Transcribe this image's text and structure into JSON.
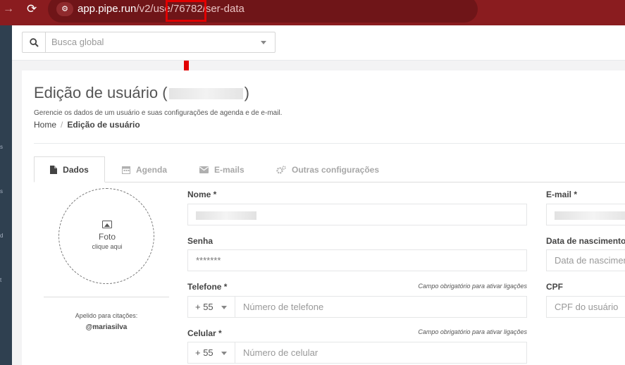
{
  "browser": {
    "url_host": "app.pipe.run",
    "url_path": "/v2/user/76782/user-data",
    "url_visible_start": "/v2/use",
    "url_visible_highlight": "/76782/",
    "url_visible_end": "ser-data"
  },
  "topbar": {
    "search_placeholder": "Busca global"
  },
  "page": {
    "title_prefix": "Edição de usuário (",
    "title_suffix": ")",
    "subtitle": "Gerencie os dados de um usuário e suas configurações de agenda e de e-mail.",
    "breadcrumb_home": "Home",
    "breadcrumb_sep": "/",
    "breadcrumb_current": "Edição de usuário"
  },
  "tabs": [
    {
      "label": "Dados",
      "icon": "file-icon"
    },
    {
      "label": "Agenda",
      "icon": "calendar-icon"
    },
    {
      "label": "E-mails",
      "icon": "envelope-icon"
    },
    {
      "label": "Outras configurações",
      "icon": "cogs-icon"
    }
  ],
  "photo": {
    "title": "Foto",
    "subtitle": "clique aqui",
    "nickname_label": "Apelido para citações:",
    "nickname_value": "@mariasilva"
  },
  "form": {
    "name_label": "Nome *",
    "password_label": "Senha",
    "password_value": "*******",
    "phone_label": "Telefone *",
    "phone_hint": "Campo obrigatório para ativar ligações",
    "phone_ddi": "+ 55",
    "phone_placeholder": "Número de telefone",
    "cell_label": "Celular *",
    "cell_hint": "Campo obrigatório para ativar ligações",
    "cell_ddi": "+ 55",
    "cell_placeholder": "Número de celular",
    "email_label": "E-mail *",
    "birth_label": "Data de nascimento",
    "birth_placeholder": "Data de nascimento",
    "cpf_label": "CPF",
    "cpf_placeholder": "CPF do usuário"
  },
  "rail": [
    "s",
    "s",
    "d",
    "t"
  ],
  "colors": {
    "browser_bar": "#8a1c1f",
    "highlight": "#e10000",
    "sidebar": "#2f4050"
  }
}
